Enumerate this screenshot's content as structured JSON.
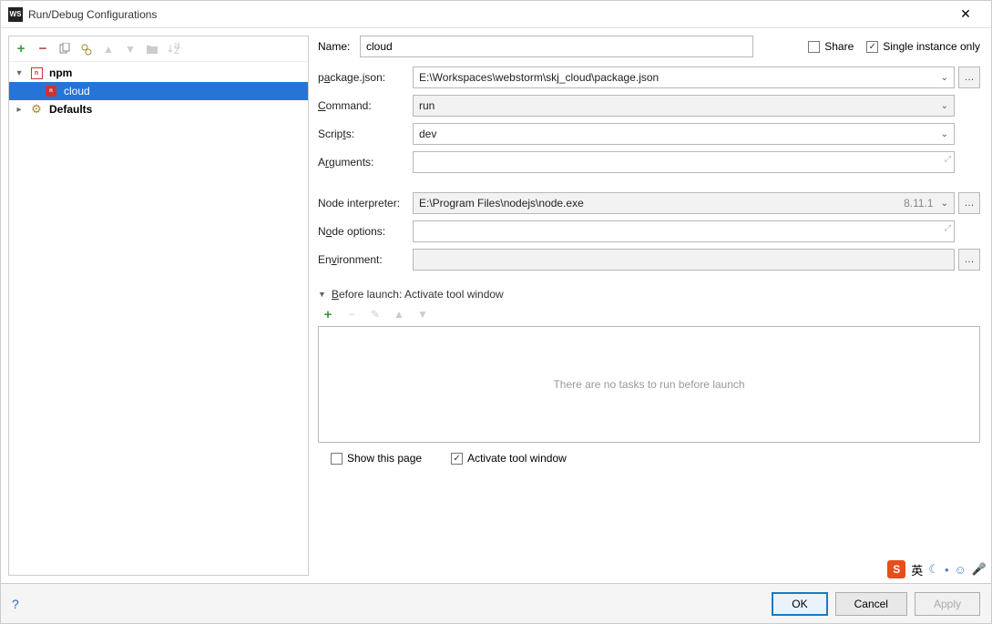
{
  "window": {
    "title": "Run/Debug Configurations"
  },
  "tree": {
    "npm": "npm",
    "cloud": "cloud",
    "defaults": "Defaults"
  },
  "form": {
    "name_label": "Name:",
    "name_value": "cloud",
    "share_label": "Share",
    "single_instance_label": "Single instance only",
    "package_label_pre": "p",
    "package_label_u": "a",
    "package_label_post": "ckage.json:",
    "package_value": "E:\\Workspaces\\webstorm\\skj_cloud\\package.json",
    "command_label_u": "C",
    "command_label_post": "ommand:",
    "command_value": "run",
    "scripts_label_pre": "Scrip",
    "scripts_label_u": "t",
    "scripts_label_post": "s:",
    "scripts_value": "dev",
    "arguments_label_pre": "A",
    "arguments_label_u": "r",
    "arguments_label_post": "guments:",
    "node_interpreter_label": "Node interpreter:",
    "node_interpreter_value": "E:\\Program Files\\nodejs\\node.exe",
    "node_interpreter_hint": "8.11.1",
    "node_options_label_pre": "N",
    "node_options_label_u": "o",
    "node_options_label_post": "de options:",
    "environment_label_pre": "En",
    "environment_label_u": "v",
    "environment_label_post": "ironment:"
  },
  "before": {
    "header_pre": "",
    "header_u": "B",
    "header_post": "efore launch: Activate tool window",
    "empty_text": "There are no tasks to run before launch",
    "show_page": "Show this page",
    "activate_tool": "Activate tool window"
  },
  "footer": {
    "ok": "OK",
    "cancel": "Cancel",
    "apply": "Apply"
  },
  "tray": {
    "lang": "英"
  }
}
